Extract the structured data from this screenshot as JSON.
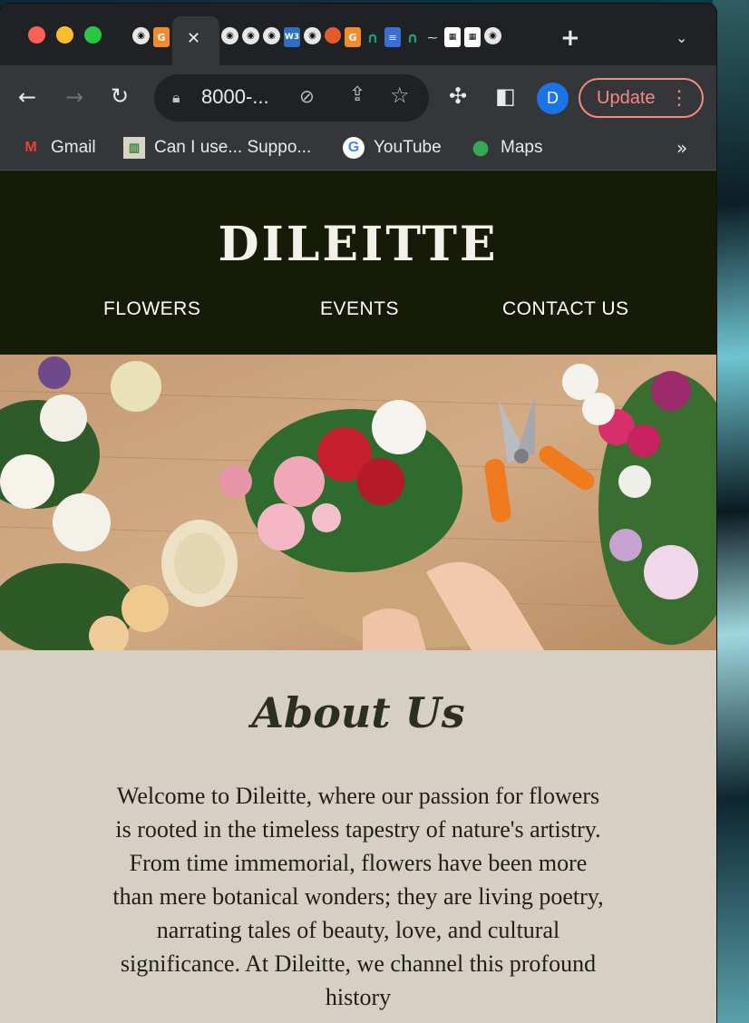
{
  "browser": {
    "active_tab_close": "✕",
    "new_tab": "+",
    "tab_search": "⌄",
    "address": "8000-...",
    "update_label": "Update",
    "avatar_initial": "D",
    "bookmarks": [
      {
        "label": "Gmail",
        "icon": "gmail-icon"
      },
      {
        "label": "Can I use... Suppo...",
        "icon": "caniuse-icon"
      },
      {
        "label": "YouTube",
        "icon": "google-icon"
      },
      {
        "label": "Maps",
        "icon": "maps-icon"
      }
    ],
    "bookmarks_more": "»"
  },
  "site": {
    "brand": "DILEITTE",
    "nav": [
      "FLOWERS",
      "EVENTS",
      "CONTACT US"
    ],
    "about_title": "About Us",
    "about_body": "Welcome to Dileitte, where our passion for flowers is rooted in the timeless tapestry of nature's artistry. From time immemorial, flowers have been more than mere botanical wonders; they are living poetry, narrating tales of beauty, love, and cultural significance. At Dileitte, we channel this profound history"
  },
  "colors": {
    "header_bg": "#151b07",
    "about_bg": "#d5d0c3",
    "update_accent": "#f28b82",
    "avatar_bg": "#1a73e8"
  }
}
